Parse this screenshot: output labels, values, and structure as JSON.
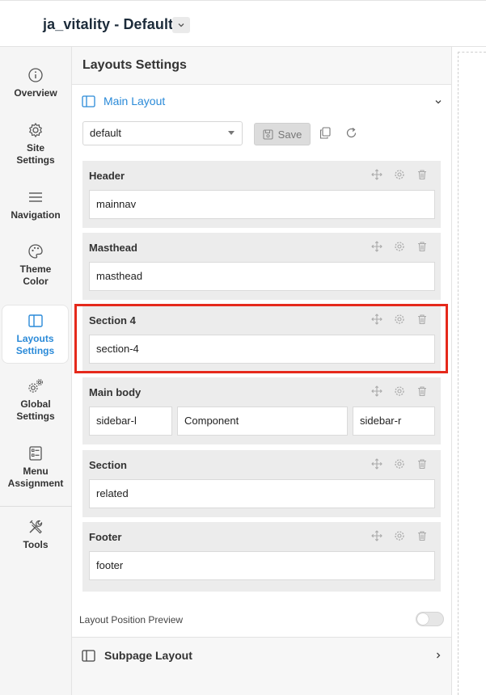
{
  "header": {
    "site_title": "ja_vitality - Default",
    "dropdown_icon": "chevron-down-icon"
  },
  "sidebar": {
    "items": [
      {
        "label_lines": [
          "Overview"
        ],
        "icon": "info-circle-icon",
        "active": false
      },
      {
        "label_lines": [
          "Site",
          "Settings"
        ],
        "icon": "gear-icon",
        "active": false
      },
      {
        "label_lines": [
          "Navigation"
        ],
        "icon": "menu-bars-icon",
        "active": false
      },
      {
        "label_lines": [
          "Theme",
          "Color"
        ],
        "icon": "palette-icon",
        "active": false
      },
      {
        "label_lines": [
          "Layouts",
          "Settings"
        ],
        "icon": "columns-icon",
        "active": true
      },
      {
        "label_lines": [
          "Global",
          "Settings"
        ],
        "icon": "gears-icon",
        "active": false
      },
      {
        "label_lines": [
          "Menu",
          "Assignment"
        ],
        "icon": "list-check-icon",
        "active": false
      },
      {
        "label_lines": [
          "Tools"
        ],
        "icon": "tools-icon",
        "active": false
      }
    ]
  },
  "panel": {
    "title": "Layouts Settings",
    "main_layout_label": "Main Layout",
    "preset_select": {
      "value": "default"
    },
    "save_label": "Save",
    "sections": [
      {
        "title": "Header",
        "positions": [
          "mainnav"
        ]
      },
      {
        "title": "Masthead",
        "positions": [
          "masthead"
        ]
      },
      {
        "title": "Section 4",
        "positions": [
          "section-4"
        ],
        "highlighted": true
      },
      {
        "title": "Main body",
        "positions": [
          "sidebar-l",
          "Component",
          "sidebar-r"
        ]
      },
      {
        "title": "Section",
        "positions": [
          "related"
        ]
      },
      {
        "title": "Footer",
        "positions": [
          "footer"
        ]
      }
    ],
    "preview_label": "Layout Position Preview",
    "preview_toggle_on": false,
    "subpage_label": "Subpage Layout"
  },
  "colors": {
    "accent": "#2a8ad8",
    "highlight": "#e5291b"
  }
}
